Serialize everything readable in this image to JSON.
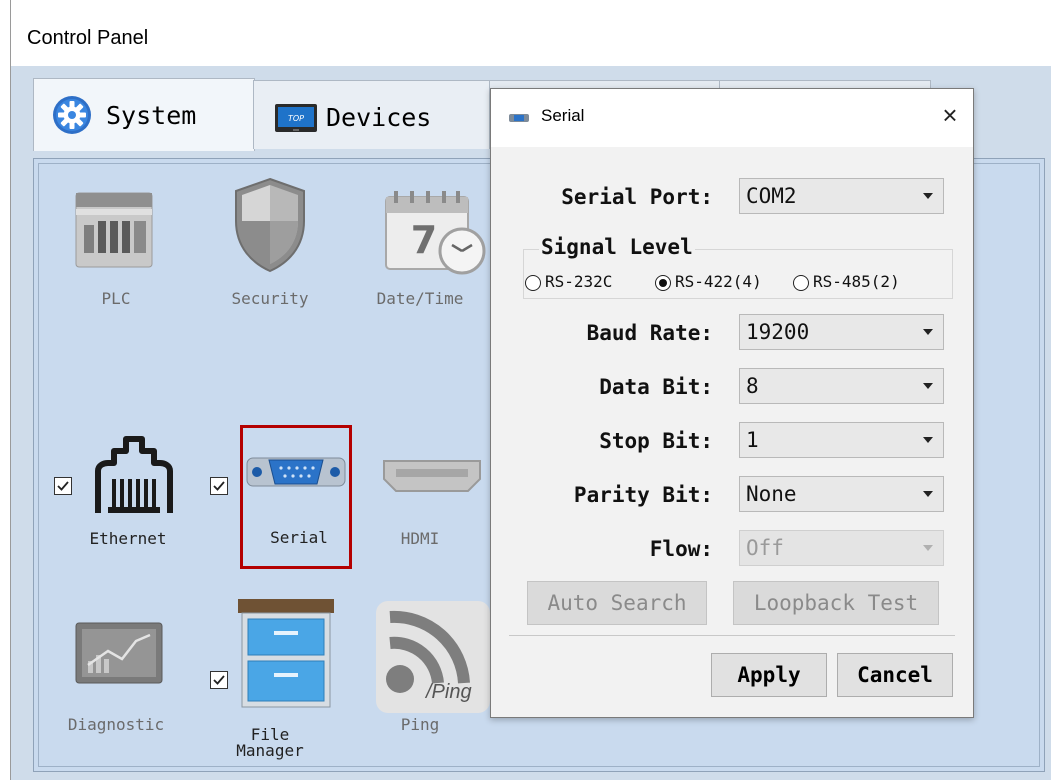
{
  "window": {
    "title": "Control Panel"
  },
  "tabs": [
    {
      "label": "System",
      "icon": "gear-icon",
      "active": true
    },
    {
      "label": "Devices",
      "icon": "top-device-icon",
      "active": false
    }
  ],
  "items": {
    "plc": {
      "label": "PLC"
    },
    "security": {
      "label": "Security"
    },
    "datetime": {
      "label": "Date/Time",
      "calendar_day": "7"
    },
    "ethernet": {
      "label": "Ethernet",
      "checked": true
    },
    "serial": {
      "label": "Serial",
      "checked": true
    },
    "hdmi": {
      "label": "HDMI"
    },
    "diagnostic": {
      "label": "Diagnostic"
    },
    "file_manager": {
      "label_line1": "File",
      "label_line2": "Manager",
      "checked": true
    },
    "ping": {
      "label": "Ping",
      "icon_text": "/Ping"
    }
  },
  "highlight_color": "#b40000",
  "dialog": {
    "title": "Serial",
    "close_glyph": "×",
    "serial_port": {
      "label": "Serial Port:",
      "value": "COM2"
    },
    "signal_level": {
      "label": "Signal Level",
      "options": [
        "RS-232C",
        "RS-422(4)",
        "RS-485(2)"
      ],
      "selected": "RS-422(4)"
    },
    "baud_rate": {
      "label": "Baud Rate:",
      "value": "19200"
    },
    "data_bit": {
      "label": "Data Bit:",
      "value": "8"
    },
    "stop_bit": {
      "label": "Stop Bit:",
      "value": "1"
    },
    "parity_bit": {
      "label": "Parity Bit:",
      "value": "None"
    },
    "flow": {
      "label": "Flow:",
      "value": "Off",
      "disabled": true
    },
    "auto_search_label": "Auto Search",
    "loopback_label": "Loopback Test",
    "apply_label": "Apply",
    "cancel_label": "Cancel"
  }
}
